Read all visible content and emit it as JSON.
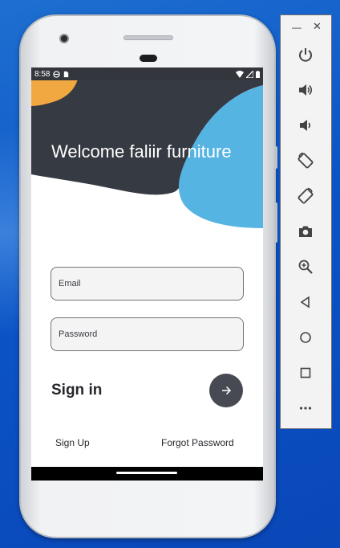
{
  "status_bar": {
    "time": "8:58",
    "left_icons": [
      "dnd-icon",
      "sim-icon"
    ],
    "right_icons": [
      "wifi-icon",
      "signal-icon",
      "battery-icon"
    ]
  },
  "app": {
    "welcome_title": "Welcome faliir furniture",
    "email_placeholder": "Email",
    "password_placeholder": "Password",
    "sign_in_label": "Sign in",
    "sign_up_link": "Sign Up",
    "forgot_password_link": "Forgot Password"
  },
  "colors": {
    "dark_blob": "#363a42",
    "orange_blob": "#f2a841",
    "blue_blob": "#56b4e3",
    "button": "#474a52"
  },
  "emulator_toolbar": {
    "window_controls": [
      "minimize-icon",
      "close-icon"
    ],
    "buttons": [
      "power-icon",
      "volume-up-icon",
      "volume-down-icon",
      "rotate-left-icon",
      "rotate-right-icon",
      "camera-icon",
      "zoom-icon",
      "back-icon",
      "home-icon",
      "overview-icon",
      "more-icon"
    ]
  }
}
